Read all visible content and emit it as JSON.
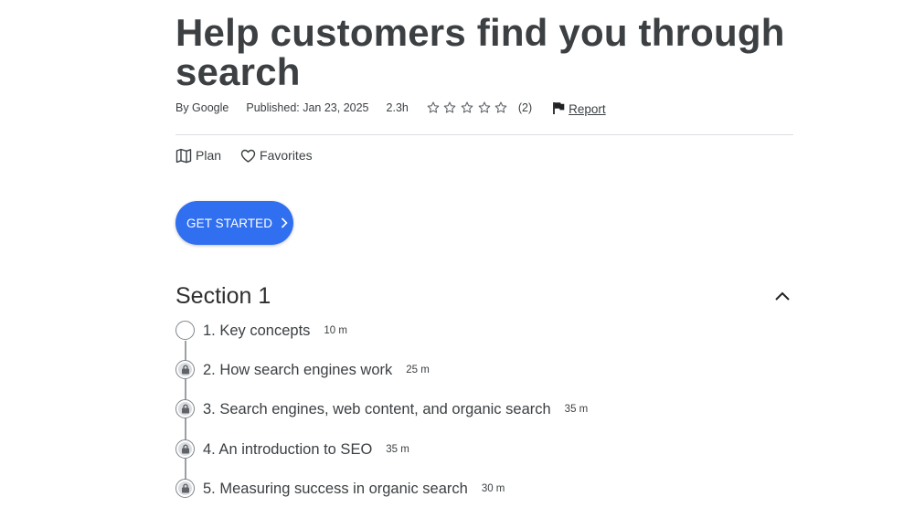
{
  "course": {
    "title": "Help customers find you through search",
    "author": "By Google",
    "published": "Published: Jan 23, 2025",
    "duration": "2.3h",
    "rating_stars": 0,
    "rating_max": 5,
    "rating_count": "(2)",
    "report_label": "Report"
  },
  "actions": {
    "plan_label": "Plan",
    "favorites_label": "Favorites"
  },
  "cta": {
    "label": "GET STARTED",
    "color": "#2f6ff0"
  },
  "section": {
    "title": "Section 1",
    "expanded": true,
    "steps": [
      {
        "label": "1. Key concepts",
        "duration": "10 m",
        "locked": false
      },
      {
        "label": "2. How search engines work",
        "duration": "25 m",
        "locked": true
      },
      {
        "label": "3. Search engines, web content, and organic search",
        "duration": "35 m",
        "locked": true
      },
      {
        "label": "4. An introduction to SEO",
        "duration": "35 m",
        "locked": true
      },
      {
        "label": "5. Measuring success in organic search",
        "duration": "30 m",
        "locked": true
      }
    ]
  },
  "icons": {
    "star": "star-outline-icon",
    "report": "flag-icon",
    "plan": "map-icon",
    "favorites": "heart-outline-icon",
    "cta": "chevron-right-icon",
    "collapse": "chevron-up-icon",
    "step_locked": "lock-icon",
    "step_open": "empty-circle-icon"
  }
}
